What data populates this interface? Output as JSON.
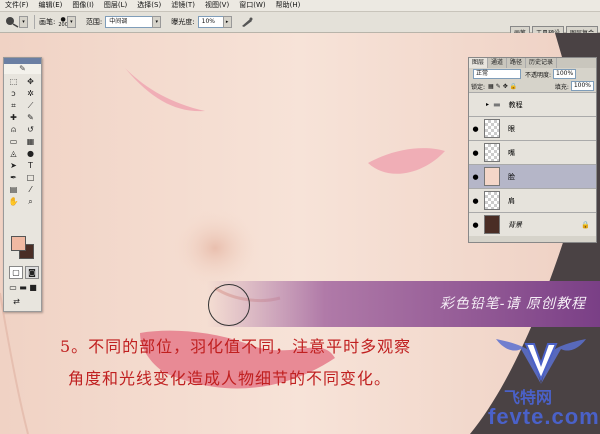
{
  "menu": [
    "文件(F)",
    "编辑(E)",
    "图像(I)",
    "图层(L)",
    "选择(S)",
    "滤镜(T)",
    "视图(V)",
    "窗口(W)",
    "帮助(H)"
  ],
  "options": {
    "brush_label": "画笔:",
    "brush_size": "200",
    "range_label": "范围:",
    "range_value": "中间调",
    "exposure_label": "曝光度:",
    "exposure_value": "10%"
  },
  "palette_wells": [
    "画笔",
    "工具预设",
    "图层复合"
  ],
  "layers_panel": {
    "tabs": [
      "图层",
      "通道",
      "路径",
      "历史记录"
    ],
    "blend_mode": "正常",
    "opacity_label": "不透明度:",
    "opacity_value": "100%",
    "lock_label": "锁定:",
    "fill_label": "填充:",
    "fill_value": "100%",
    "layers": [
      {
        "name": "教程",
        "type": "group"
      },
      {
        "name": "眼",
        "type": "layer"
      },
      {
        "name": "嘴",
        "type": "layer"
      },
      {
        "name": "脸",
        "type": "layer",
        "selected": true
      },
      {
        "name": "肩",
        "type": "layer"
      },
      {
        "name": "背景",
        "type": "background"
      }
    ]
  },
  "banner": "彩色铅笔-请 原创教程",
  "caption": {
    "line1": "5。不同的部位，羽化值不同，注意平时多观察",
    "line2": "角度和光线变化造成人物细节的不同变化。"
  },
  "watermark": {
    "text_cn": "飞特网",
    "url": "fevte.com"
  },
  "colors": {
    "skin": "#f5ddd0",
    "lips": "#e88a95",
    "banner_purple": "#7a3f86",
    "caption_red": "#c02020",
    "foreground": "#f0b9a2",
    "background": "#4a2d25"
  }
}
